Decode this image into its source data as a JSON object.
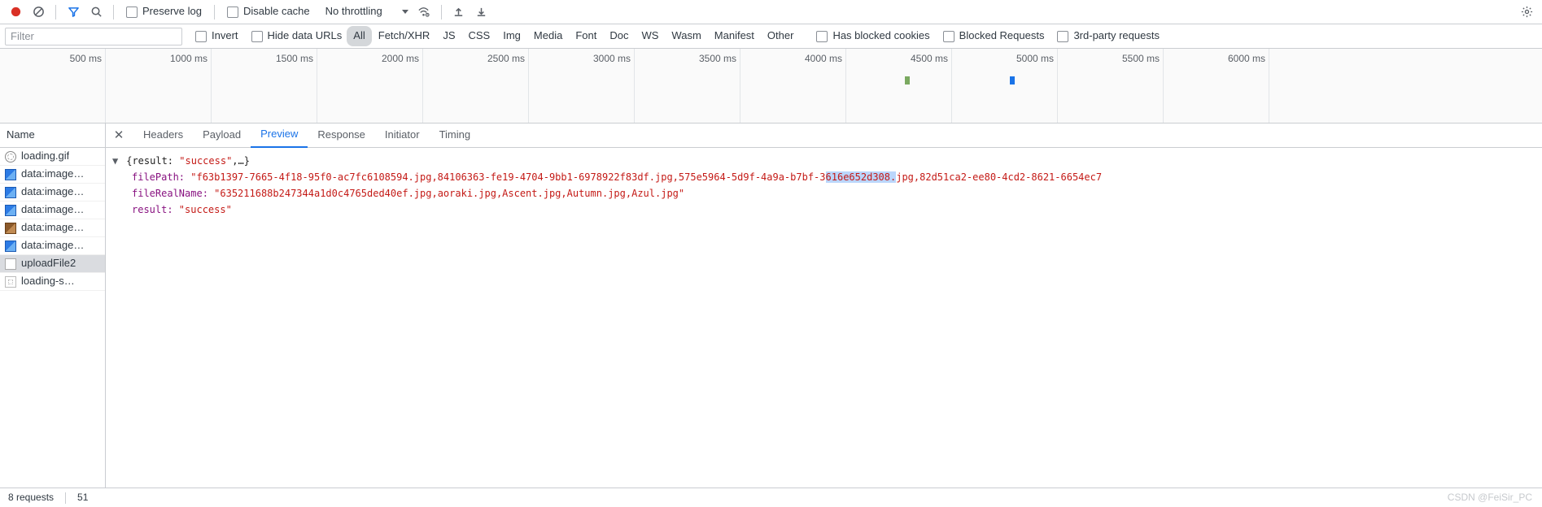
{
  "toolbar": {
    "preserve_log": "Preserve log",
    "disable_cache": "Disable cache",
    "throttling": "No throttling"
  },
  "filterbar": {
    "placeholder": "Filter",
    "invert": "Invert",
    "hide_data_urls": "Hide data URLs",
    "types": [
      "All",
      "Fetch/XHR",
      "JS",
      "CSS",
      "Img",
      "Media",
      "Font",
      "Doc",
      "WS",
      "Wasm",
      "Manifest",
      "Other"
    ],
    "has_blocked_cookies": "Has blocked cookies",
    "blocked_requests": "Blocked Requests",
    "third_party": "3rd-party requests"
  },
  "timeline": {
    "ticks": [
      "500 ms",
      "1000 ms",
      "1500 ms",
      "2000 ms",
      "2500 ms",
      "3000 ms",
      "3500 ms",
      "4000 ms",
      "4500 ms",
      "5000 ms",
      "5500 ms",
      "6000 ms"
    ]
  },
  "names": {
    "header": "Name",
    "rows": [
      {
        "icon": "gif",
        "label": "loading.gif"
      },
      {
        "icon": "img",
        "label": "data:image…"
      },
      {
        "icon": "img",
        "label": "data:image…"
      },
      {
        "icon": "img",
        "label": "data:image…"
      },
      {
        "icon": "br",
        "label": "data:image…"
      },
      {
        "icon": "img",
        "label": "data:image…"
      },
      {
        "icon": "doc",
        "label": "uploadFile2",
        "selected": true
      },
      {
        "icon": "oth",
        "label": "loading-s…"
      }
    ]
  },
  "tabs": [
    "Headers",
    "Payload",
    "Preview",
    "Response",
    "Initiator",
    "Timing"
  ],
  "active_tab": "Preview",
  "preview": {
    "summary_pre": "{result: ",
    "summary_val": "\"success\"",
    "summary_post": ",…}",
    "filePath_key": "filePath: ",
    "filePath_val_a": "\"f63b1397-7665-4f18-95f0-ac7fc6108594.jpg,84106363-fe19-4704-9bb1-6978922f83df.jpg,575e5964-5d9f-4a9a-b7bf-3",
    "filePath_val_sel": "616e652d308.",
    "filePath_val_b": "jpg,82d51ca2-ee80-4cd2-8621-6654ec7",
    "fileRealName_key": "fileRealName: ",
    "fileRealName_val": "\"635211688b247344a1d0c4765ded40ef.jpg,aoraki.jpg,Ascent.jpg,Autumn.jpg,Azul.jpg\"",
    "result_key": "result: ",
    "result_val": "\"success\""
  },
  "status": {
    "requests": "8 requests",
    "transferred": "51"
  },
  "watermark": "CSDN @FeiSir_PC"
}
